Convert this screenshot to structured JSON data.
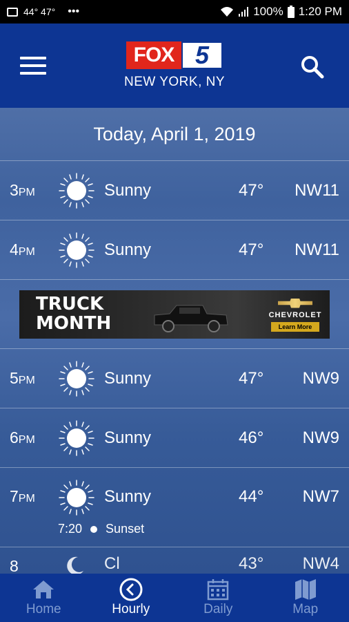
{
  "status_bar": {
    "temps": "44° 47°",
    "dots": "•••",
    "battery": "100%",
    "time": "1:20 PM"
  },
  "header": {
    "logo_fox": "FOX",
    "logo_num": "5",
    "location": "NEW YORK, NY"
  },
  "date": "Today, April 1, 2019",
  "hours": [
    {
      "hour": "3",
      "ampm": "PM",
      "condition": "Sunny",
      "temp": "47°",
      "wind": "NW11",
      "icon": "sun-icon"
    },
    {
      "hour": "4",
      "ampm": "PM",
      "condition": "Sunny",
      "temp": "47°",
      "wind": "NW11",
      "icon": "sun-icon"
    },
    {
      "hour": "5",
      "ampm": "PM",
      "condition": "Sunny",
      "temp": "47°",
      "wind": "NW9",
      "icon": "sun-icon"
    },
    {
      "hour": "6",
      "ampm": "PM",
      "condition": "Sunny",
      "temp": "46°",
      "wind": "NW9",
      "icon": "sun-icon"
    },
    {
      "hour": "7",
      "ampm": "PM",
      "condition": "Sunny",
      "temp": "44°",
      "wind": "NW7",
      "icon": "sun-icon"
    }
  ],
  "sunset": {
    "time": "7:20",
    "label": "Sunset"
  },
  "partial_row": {
    "hour": "8",
    "condition": "Cl",
    "temp": "43°",
    "wind": "NW4",
    "icon": "moon-icon"
  },
  "ad": {
    "title_line1": "TRUCK",
    "title_line2": "MONTH",
    "brand": "CHEVROLET",
    "cta": "Learn More"
  },
  "nav": [
    {
      "label": "Home",
      "icon": "home-icon",
      "active": false
    },
    {
      "label": "Hourly",
      "icon": "clock-icon",
      "active": true
    },
    {
      "label": "Daily",
      "icon": "calendar-icon",
      "active": false
    },
    {
      "label": "Map",
      "icon": "map-icon",
      "active": false
    }
  ],
  "colors": {
    "header_bg": "#0d3593",
    "fox_red": "#e1261c",
    "nav_inactive": "#7f9bd0"
  }
}
